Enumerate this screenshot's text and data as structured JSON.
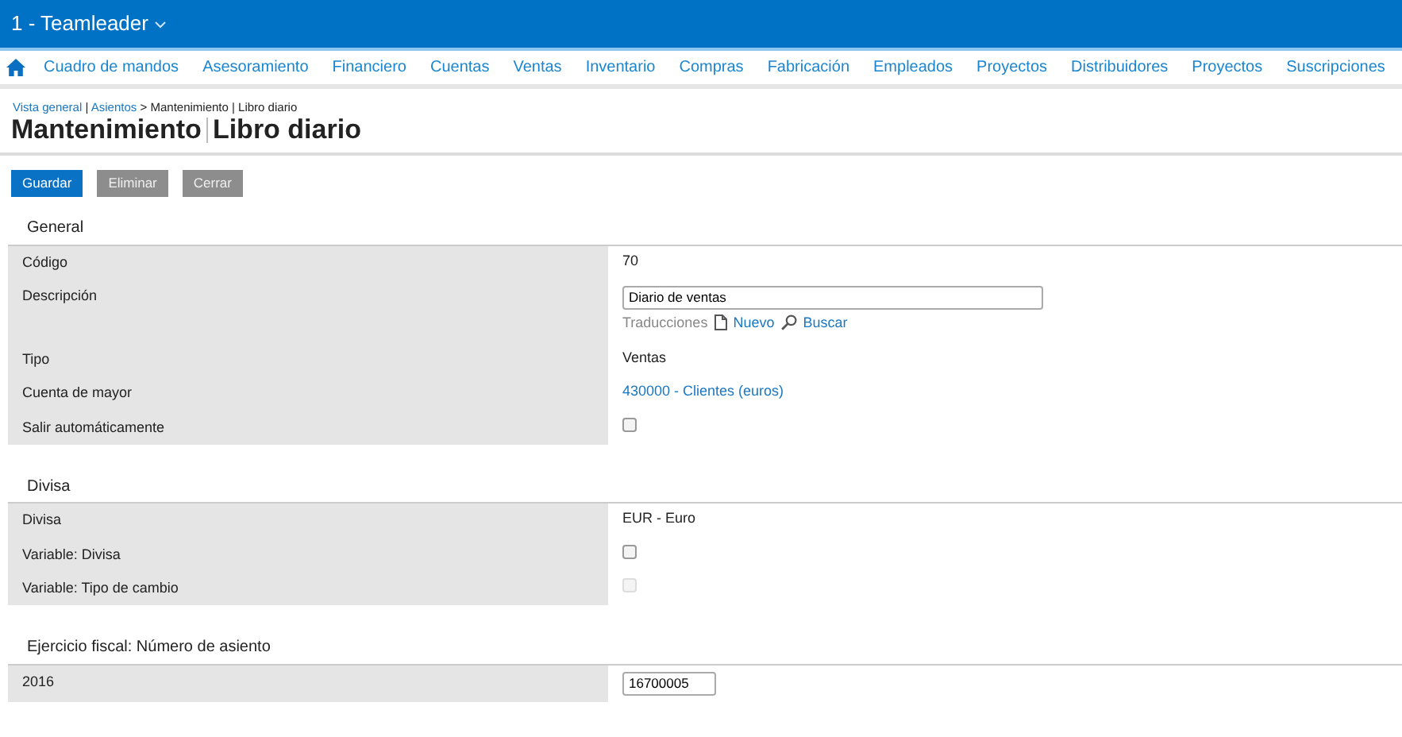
{
  "topbar": {
    "title": "1 - Teamleader"
  },
  "nav": {
    "items": [
      {
        "label": "Cuadro de mandos"
      },
      {
        "label": "Asesoramiento"
      },
      {
        "label": "Financiero"
      },
      {
        "label": "Cuentas"
      },
      {
        "label": "Ventas"
      },
      {
        "label": "Inventario"
      },
      {
        "label": "Compras"
      },
      {
        "label": "Fabricación"
      },
      {
        "label": "Empleados"
      },
      {
        "label": "Proyectos"
      },
      {
        "label": "Distribuidores"
      },
      {
        "label": "Proyectos"
      },
      {
        "label": "Suscripciones"
      }
    ]
  },
  "breadcrumb": [
    {
      "kind": "link",
      "text": "Vista general"
    },
    {
      "kind": "sep",
      "text": "|"
    },
    {
      "kind": "link",
      "text": "Asientos"
    },
    {
      "kind": "sep",
      "text": ">"
    },
    {
      "kind": "text",
      "text": "Mantenimiento | Libro diario"
    }
  ],
  "page_title": {
    "main": "Mantenimiento",
    "sub": "Libro diario"
  },
  "buttons": [
    {
      "label": "Guardar",
      "kind": "primary"
    },
    {
      "label": "Eliminar",
      "kind": "secondary"
    },
    {
      "label": "Cerrar",
      "kind": "secondary"
    }
  ],
  "sections": [
    {
      "title": "General",
      "rows": [
        {
          "label": "Código",
          "kind": "text",
          "value": "70"
        },
        {
          "label": "Descripción",
          "kind": "input",
          "value": "Diario de ventas",
          "translations": {
            "label": "Traducciones",
            "new": "Nuevo",
            "search": "Buscar"
          }
        },
        {
          "label": "Tipo",
          "kind": "text",
          "value": "Ventas"
        },
        {
          "label": "Cuenta de mayor",
          "kind": "link",
          "value": "430000 - Clientes (euros)"
        },
        {
          "label": "Salir automáticamente",
          "kind": "checkbox",
          "checked": false,
          "disabled": false
        }
      ]
    },
    {
      "title": "Divisa",
      "rows": [
        {
          "label": "Divisa",
          "kind": "text",
          "value": "EUR - Euro"
        },
        {
          "label": "Variable: Divisa",
          "kind": "checkbox",
          "checked": false,
          "disabled": false
        },
        {
          "label": "Variable: Tipo de cambio",
          "kind": "checkbox",
          "checked": false,
          "disabled": true
        }
      ]
    },
    {
      "title": "Ejercicio fiscal: Número de asiento",
      "rows": [
        {
          "label": "2016",
          "kind": "shortinput",
          "value": "16700005"
        }
      ]
    }
  ]
}
